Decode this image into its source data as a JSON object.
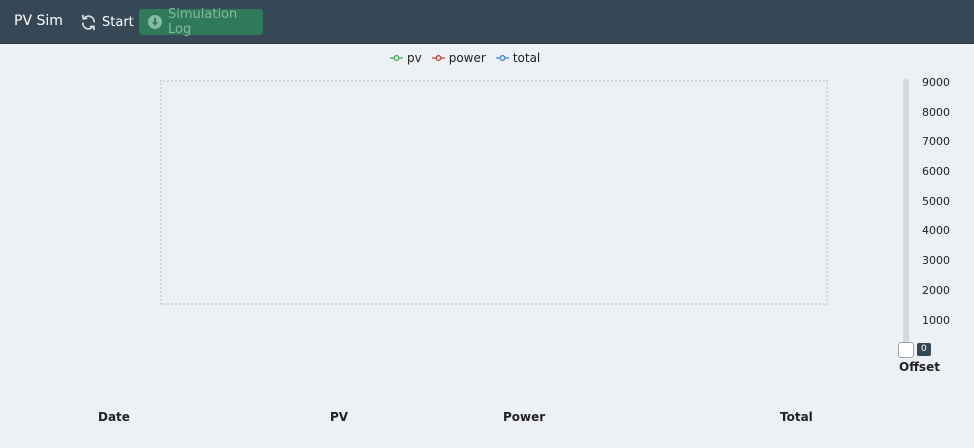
{
  "navbar": {
    "brand": "PV Sim",
    "start_label": "Start",
    "log_label": "Simulation Log"
  },
  "legend": {
    "items": [
      {
        "label": "pv",
        "color": "#3aa64a"
      },
      {
        "label": "power",
        "color": "#c0392b"
      },
      {
        "label": "total",
        "color": "#2f7fd8"
      }
    ]
  },
  "offset_slider": {
    "label": "Offset",
    "value": "0",
    "ticks": [
      "9000",
      "8000",
      "7000",
      "6000",
      "5000",
      "4000",
      "3000",
      "2000",
      "1000"
    ]
  },
  "table": {
    "headers": [
      "Date",
      "PV",
      "Power",
      "Total"
    ]
  }
}
